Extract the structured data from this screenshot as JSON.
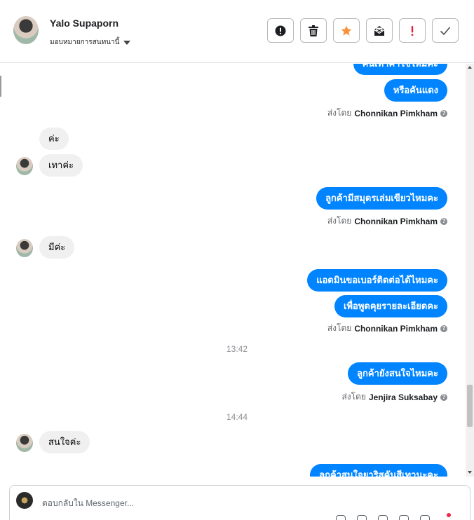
{
  "header": {
    "contact_name": "Yalo Supaporn",
    "assign_label": "มอบหมายการสนทนานี้",
    "actions": [
      {
        "name": "report-button",
        "icon": "alert-circle-icon"
      },
      {
        "name": "delete-button",
        "icon": "trash-icon"
      },
      {
        "name": "star-button",
        "icon": "star-icon",
        "color": "#f7923b"
      },
      {
        "name": "mark-unread-button",
        "icon": "envelope-icon"
      },
      {
        "name": "spam-button",
        "icon": "exclamation-icon",
        "color": "#e41e3f"
      },
      {
        "name": "done-button",
        "icon": "check-icon"
      }
    ]
  },
  "messages": {
    "m1": "คันเทาค่าใช่ไหมคะ",
    "m2": "หรือคันแดง",
    "sent1": {
      "prefix": "ส่งโดย",
      "agent": "Chonnikan Pimkham"
    },
    "m3": "ค่ะ",
    "m4": "เทาค่ะ",
    "m5": "ลูกค้ามีสมุดรเล่มเขียวไหมคะ",
    "sent2": {
      "prefix": "ส่งโดย",
      "agent": "Chonnikan Pimkham"
    },
    "m6": "มีค่ะ",
    "m7": "แอดมินขอเบอร์ติดต่อได้ไหมคะ",
    "m8": "เพื่อพูดคุยรายละเอียดคะ",
    "sent3": {
      "prefix": "ส่งโดย",
      "agent": "Chonnikan Pimkham"
    },
    "time1": "13:42",
    "m9": "ลูกค้ายังสนใจไหมคะ",
    "sent4": {
      "prefix": "ส่งโดย",
      "agent": "Jenjira Suksabay"
    },
    "time2": "14:44",
    "m10": "สนใจค่ะ",
    "m11": "ลูกค้าสนใจยาริสคันสีเทานะคะ"
  },
  "composer": {
    "placeholder": "ตอบกลับใน Messenger..."
  },
  "colors": {
    "outgoing_bubble": "#0084ff",
    "incoming_bubble": "#f0f0f0"
  }
}
